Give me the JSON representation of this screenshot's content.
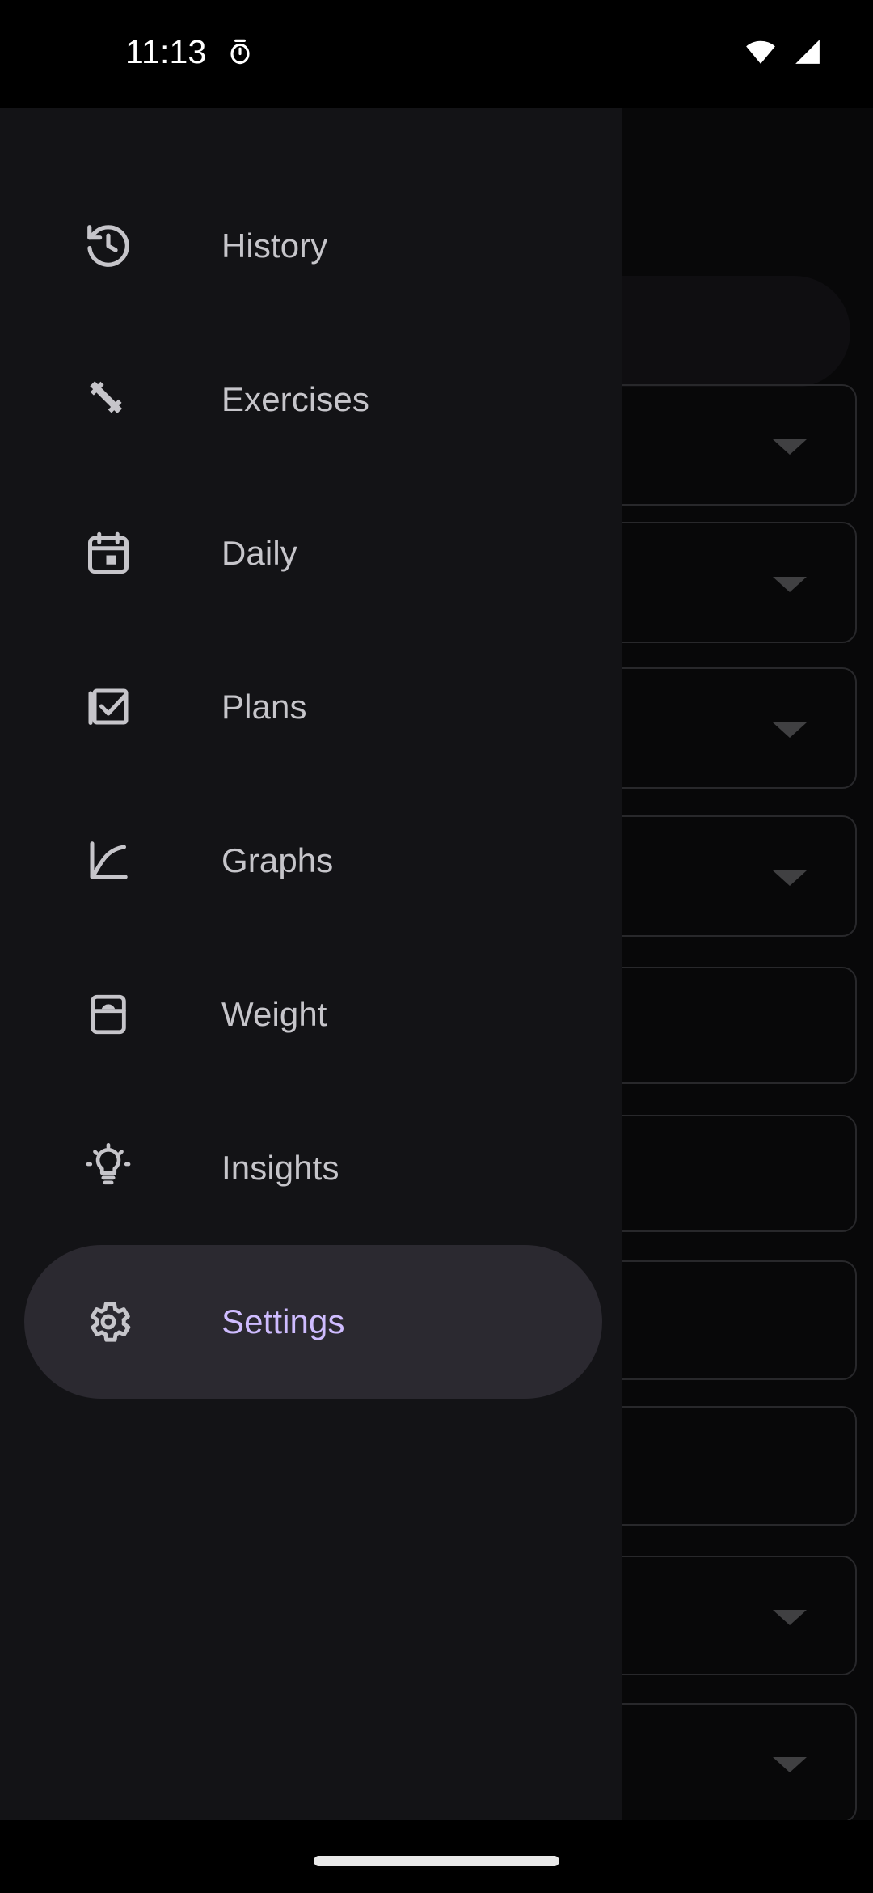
{
  "status_bar": {
    "time": "11:13",
    "icons": [
      {
        "name": "alarm-icon",
        "label": "Alarm set"
      },
      {
        "name": "wifi-icon",
        "label": "Wi-Fi"
      },
      {
        "name": "cellular-signal-icon",
        "label": "Cellular signal"
      }
    ]
  },
  "drawer": {
    "selected_index": 7,
    "accent_color": "#CFBCFF",
    "selected_background": "#2B2930",
    "surface_color": "#131316",
    "label_color": "#C6C5CA",
    "items": [
      {
        "label": "History",
        "icon": "history-icon"
      },
      {
        "label": "Exercises",
        "icon": "dumbbell-icon"
      },
      {
        "label": "Daily",
        "icon": "calendar-icon"
      },
      {
        "label": "Plans",
        "icon": "checklist-icon"
      },
      {
        "label": "Graphs",
        "icon": "line-chart-icon"
      },
      {
        "label": "Weight",
        "icon": "scale-icon"
      },
      {
        "label": "Insights",
        "icon": "lightbulb-icon"
      },
      {
        "label": "Settings",
        "icon": "gear-icon"
      }
    ]
  },
  "background_page": {
    "search_pill": {
      "name": "search-bar"
    },
    "fields": [
      {
        "has_dropdown": true
      },
      {
        "has_dropdown": true
      },
      {
        "has_dropdown": true
      },
      {
        "has_dropdown": true
      },
      {
        "has_dropdown": false
      },
      {
        "has_dropdown": false
      },
      {
        "has_dropdown": false
      },
      {
        "has_dropdown": false
      },
      {
        "has_dropdown": true
      },
      {
        "has_dropdown": true
      }
    ]
  },
  "navigation_bar": {
    "type": "gesture-pill"
  }
}
